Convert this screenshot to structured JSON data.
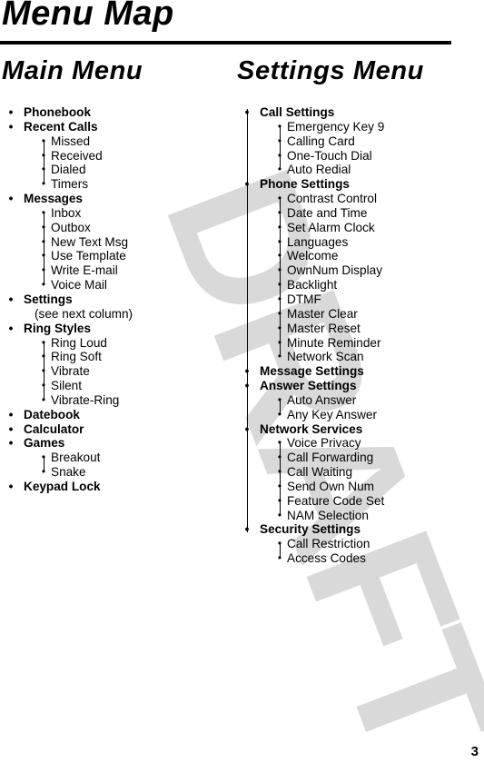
{
  "page": {
    "title": "Menu Map",
    "watermark": "DRAFT",
    "page_number": "3"
  },
  "main_menu": {
    "title": "Main Menu",
    "items": [
      {
        "label": "Phonebook",
        "sub": []
      },
      {
        "label": "Recent Calls",
        "sub": [
          "Missed",
          "Received",
          "Dialed",
          "Timers"
        ]
      },
      {
        "label": "Messages",
        "sub": [
          "Inbox",
          "Outbox",
          "New Text Msg",
          "Use Template",
          "Write E-mail",
          "Voice Mail"
        ]
      },
      {
        "label": "Settings",
        "note": "(see next column)",
        "sub": []
      },
      {
        "label": "Ring Styles",
        "sub": [
          "Ring Loud",
          "Ring Soft",
          "Vibrate",
          "Silent",
          "Vibrate-Ring"
        ]
      },
      {
        "label": "Datebook",
        "sub": []
      },
      {
        "label": "Calculator",
        "sub": []
      },
      {
        "label": "Games",
        "sub": [
          "Breakout",
          "Snake"
        ]
      },
      {
        "label": "Keypad Lock",
        "sub": []
      }
    ]
  },
  "settings_menu": {
    "title": "Settings Menu",
    "items": [
      {
        "label": "Call Settings",
        "sub": [
          "Emergency Key 9",
          "Calling Card",
          "One-Touch Dial",
          "Auto Redial"
        ]
      },
      {
        "label": "Phone Settings",
        "sub": [
          "Contrast Control",
          "Date and Time",
          "Set Alarm Clock",
          "Languages",
          "Welcome",
          "OwnNum Display",
          "Backlight",
          "DTMF",
          "Master Clear",
          "Master Reset",
          "Minute Reminder",
          "Network Scan"
        ]
      },
      {
        "label": "Message Settings",
        "sub": []
      },
      {
        "label": "Answer Settings",
        "sub": [
          "Auto Answer",
          "Any Key Answer"
        ]
      },
      {
        "label": "Network Services",
        "sub": [
          "Voice Privacy",
          "Call Forwarding",
          "Call Waiting",
          "Send Own Num",
          "Feature Code Set",
          "NAM Selection"
        ]
      },
      {
        "label": "Security Settings",
        "sub": [
          "Call Restriction",
          "Access Codes"
        ]
      }
    ]
  }
}
